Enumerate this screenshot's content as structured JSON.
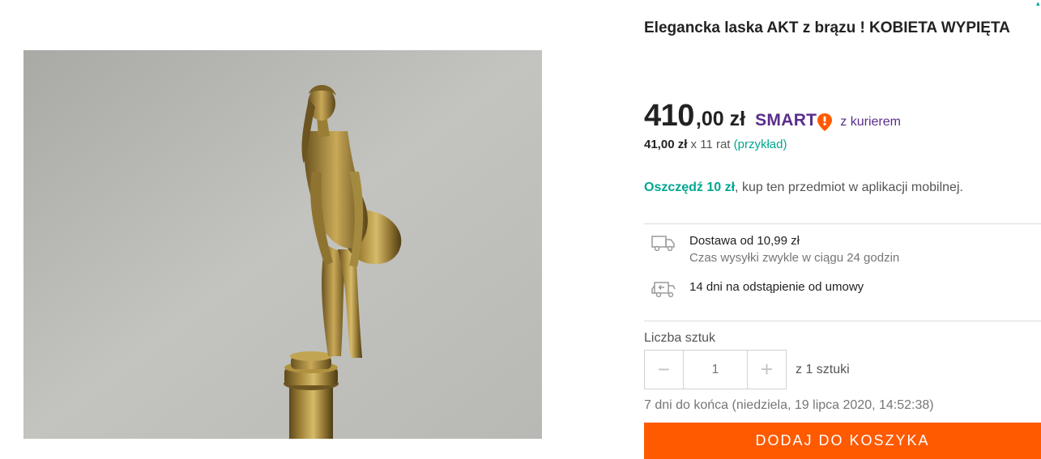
{
  "product": {
    "title": "Elegancka laska AKT z brązu ! KOBIETA WYPIĘTA",
    "image_alt": "bronze nude woman figurine cane handle"
  },
  "price": {
    "main": "410",
    "cents": ",00",
    "currency": "zł",
    "smart_label": "SMART",
    "smart_icon": "location-pin-exclamation-icon",
    "courier": "z kurierem"
  },
  "installments": {
    "amount": "41,00 zł",
    "count": "x 11 rat",
    "example_open": "(",
    "example_link": "przykład",
    "example_close": ")"
  },
  "savings": {
    "highlight": "Oszczędź 10 zł",
    "rest": ", kup ten przedmiot w aplikacji mobilnej."
  },
  "delivery": {
    "icon": "delivery-truck-icon",
    "title": "Dostawa od 10,99 zł",
    "subtitle": "Czas wysyłki zwykle w ciągu 24 godzin"
  },
  "returns": {
    "icon": "return-truck-icon",
    "title": "14 dni na odstąpienie od umowy"
  },
  "quantity": {
    "label": "Liczba sztuk",
    "value": "1",
    "minus": "−",
    "plus": "+",
    "available": "z 1 sztuki"
  },
  "deadline": "7 dni do końca (niedziela, 19 lipca 2020, 14:52:38)",
  "cart_button": "DODAJ DO KOSZYKA",
  "colors": {
    "accent_orange": "#ff5a00",
    "accent_teal": "#00a790",
    "smart_purple": "#5a2d8c",
    "smart_orange": "#ff5a00"
  }
}
